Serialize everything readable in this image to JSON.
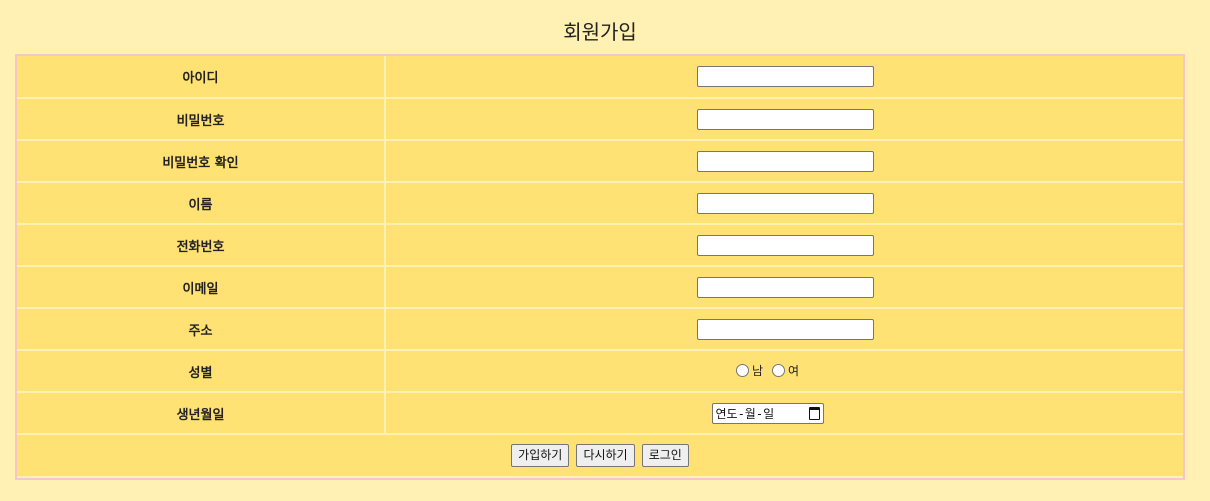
{
  "page": {
    "title": "회원가입"
  },
  "form": {
    "fields": [
      {
        "label": "아이디",
        "value": ""
      },
      {
        "label": "비밀번호",
        "value": ""
      },
      {
        "label": "비밀번호 확인",
        "value": ""
      },
      {
        "label": "이름",
        "value": ""
      },
      {
        "label": "전화번호",
        "value": ""
      },
      {
        "label": "이메일",
        "value": ""
      },
      {
        "label": "주소",
        "value": ""
      }
    ],
    "gender": {
      "label": "성별",
      "options": [
        "남",
        "여"
      ]
    },
    "birthdate": {
      "label": "생년월일",
      "placeholder": "연도-월-일"
    },
    "buttons": {
      "join": "가입하기",
      "reset": "다시하기",
      "login": "로그인"
    }
  },
  "colors": {
    "background": "#fff0b3",
    "cell": "#ffe273",
    "frame_border": "#f7c6c6"
  }
}
